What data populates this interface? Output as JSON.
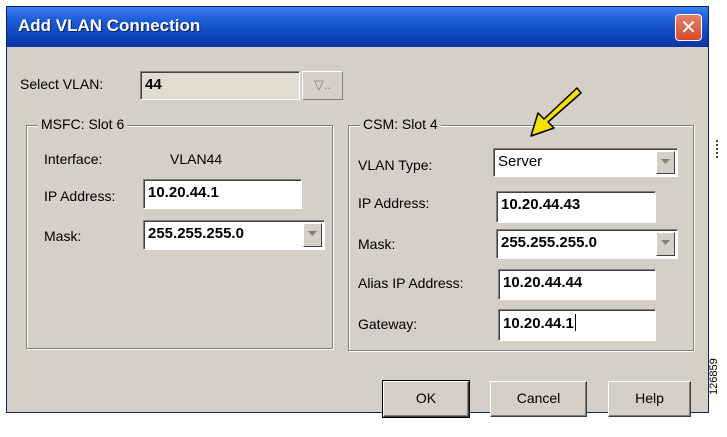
{
  "dialog": {
    "title": "Add VLAN Connection",
    "close_glyph": "✕"
  },
  "select_vlan": {
    "label": "Select VLAN:",
    "value": "44",
    "chooser_label": "▽.."
  },
  "msfc": {
    "group_title": "MSFC: Slot 6",
    "interface_label": "Interface:",
    "interface_value": "VLAN44",
    "ip_label": "IP Address:",
    "ip_value": "10.20.44.1",
    "mask_label": "Mask:",
    "mask_value": "255.255.255.0"
  },
  "csm": {
    "group_title": "CSM: Slot 4",
    "vlan_type_label": "VLAN Type:",
    "vlan_type_value": "Server",
    "ip_label": "IP Address:",
    "ip_value": "10.20.44.43",
    "mask_label": "Mask:",
    "mask_value": "255.255.255.0",
    "alias_label": "Alias IP Address:",
    "alias_value": "10.20.44.44",
    "gateway_label": "Gateway:",
    "gateway_value": "10.20.44.1"
  },
  "buttons": {
    "ok": "OK",
    "cancel": "Cancel",
    "help": "Help"
  },
  "figure_code": "126859",
  "colors": {
    "titlebar": "#0a3fb8",
    "dialog_bg": "#d4d0c8",
    "close_button": "#d24a28",
    "pointer_arrow": "#f5e100"
  },
  "icons": {
    "close": "close-icon",
    "dropdown": "chevron-down-icon",
    "pointer": "highlight-arrow-icon"
  }
}
